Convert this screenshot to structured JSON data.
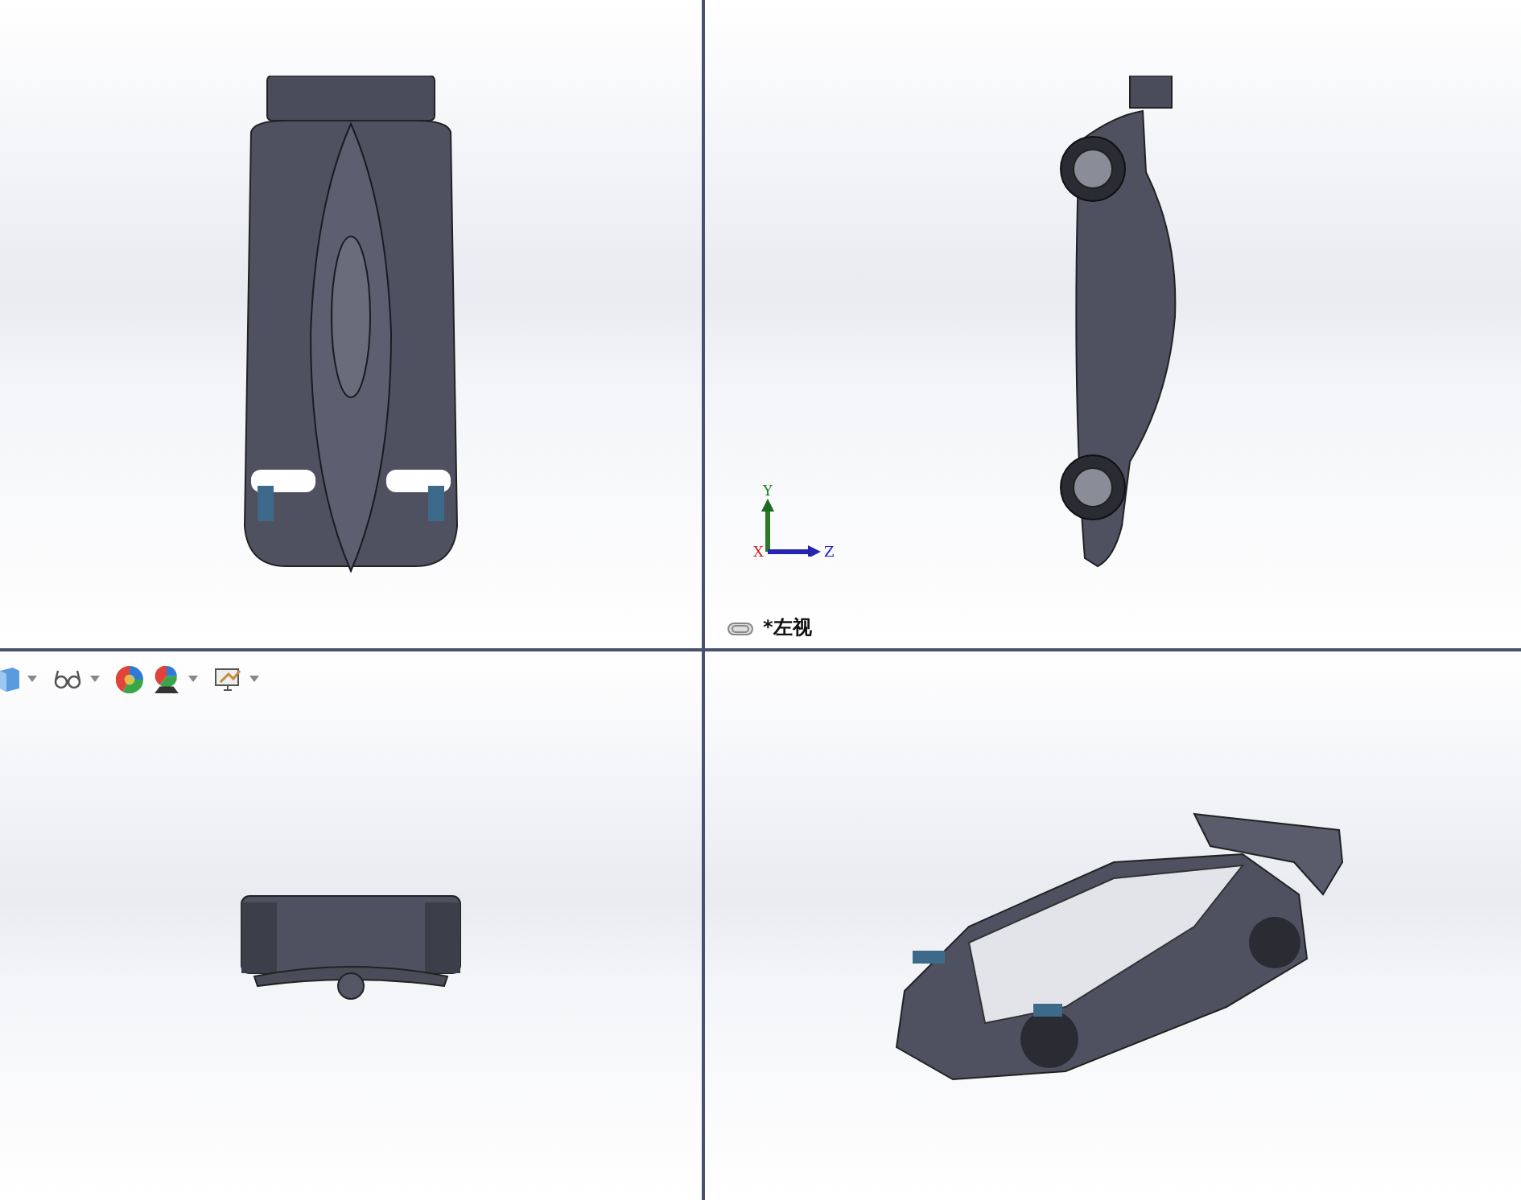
{
  "viewports": [
    {
      "kind": "top"
    },
    {
      "kind": "side",
      "label": "*左视",
      "triad": {
        "y": "Y",
        "z": "Z",
        "x": "X"
      }
    },
    {
      "kind": "front",
      "toolbar": [
        {
          "kind": "cube"
        },
        {
          "kind": "glasses"
        },
        {
          "kind": "ball"
        },
        {
          "kind": "scene"
        },
        {
          "kind": "monitor"
        }
      ]
    },
    {
      "kind": "iso"
    }
  ]
}
